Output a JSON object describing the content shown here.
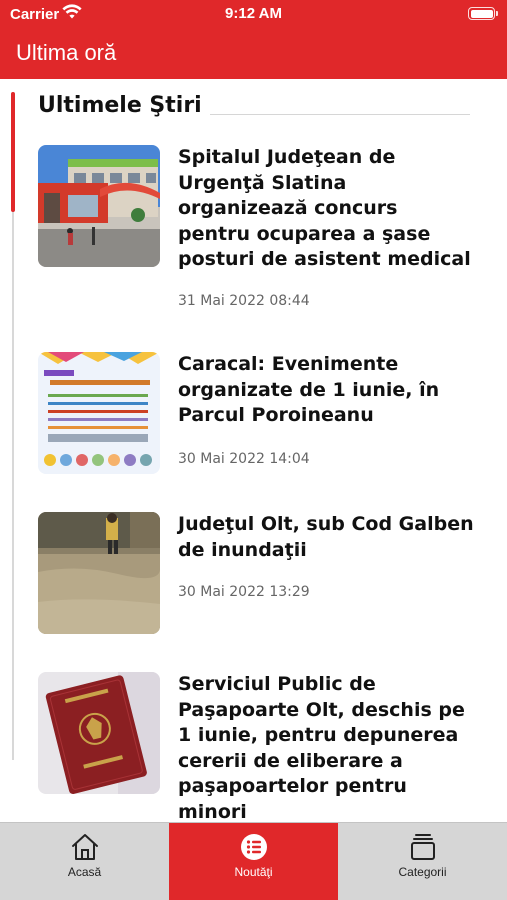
{
  "status_bar": {
    "carrier": "Carrier",
    "time": "9:12 AM"
  },
  "header": {
    "title": "Ultima oră",
    "accent_color": "#e0282a"
  },
  "section": {
    "title": "Ultimele Ştiri"
  },
  "articles": [
    {
      "title": "Spitalul Judeţean de Urgenţă Slatina organizează concurs pentru ocuparea a şase posturi de asistent medical",
      "date": "31 Mai 2022 08:44",
      "image": "hospital-building"
    },
    {
      "title": "Caracal: Evenimente organizate de 1 iunie, în Parcul Poroineanu",
      "date": "30 Mai 2022 14:04",
      "image": "childrens-day-poster"
    },
    {
      "title": "Judeţul Olt, sub Cod Galben de inundaţii",
      "date": "30 Mai 2022 13:29",
      "image": "flooded-street"
    },
    {
      "title": "Serviciul Public de Paşapoarte Olt, deschis pe 1 iunie, pentru depunerea cererii de eliberare a paşapoartelor pentru minori",
      "date": "",
      "image": "romanian-passport"
    }
  ],
  "tabs": [
    {
      "label": "Acasă",
      "icon": "home-icon",
      "active": false
    },
    {
      "label": "Noutăţi",
      "icon": "news-list-icon",
      "active": true
    },
    {
      "label": "Categorii",
      "icon": "categories-icon",
      "active": false
    }
  ]
}
